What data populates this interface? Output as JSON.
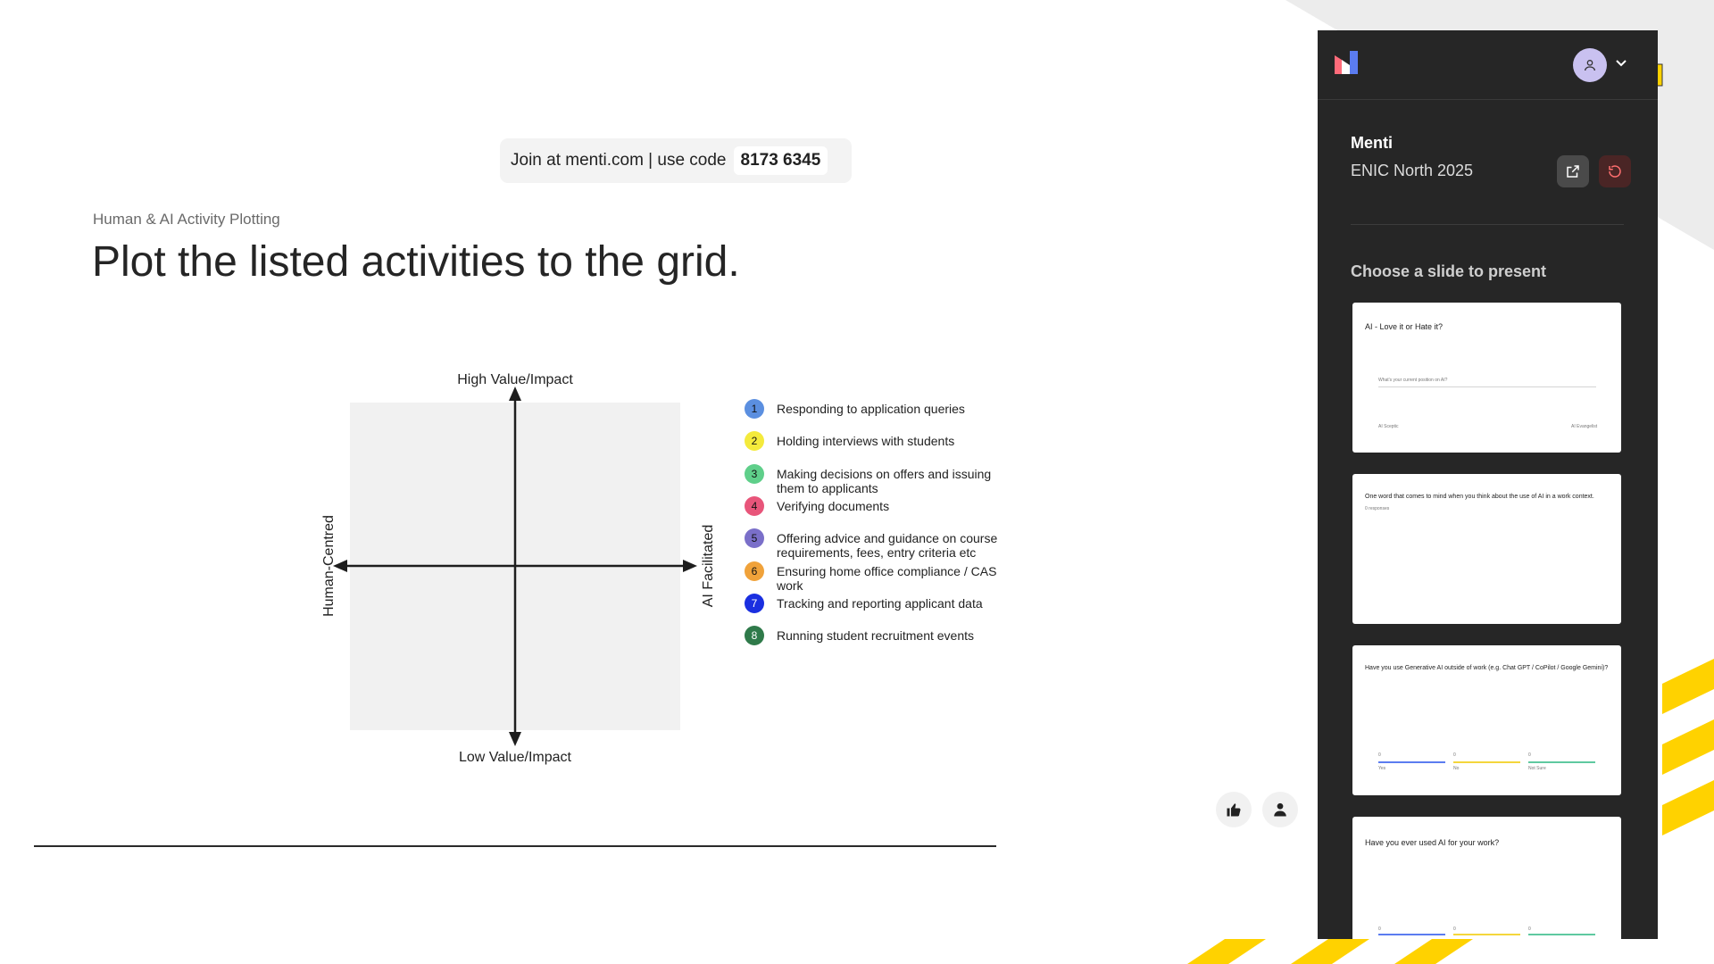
{
  "join_banner": {
    "text": "Join at menti.com | use code",
    "code": "8173 6345"
  },
  "slide": {
    "subtitle": "Human & AI Activity Plotting",
    "title": "Plot the listed activities to the grid.",
    "axes": {
      "top": "High Value/Impact",
      "bottom": "Low Value/Impact",
      "left": "Human-Centred",
      "right": "AI Facilitated"
    },
    "activities": [
      {
        "num": "1",
        "label": "Responding to application queries",
        "color": "#5b8fe0"
      },
      {
        "num": "2",
        "label": "Holding interviews with students",
        "color": "#f4ea3c"
      },
      {
        "num": "3",
        "label": "Making decisions on offers and issuing them to applicants",
        "color": "#5fcf8a"
      },
      {
        "num": "4",
        "label": "Verifying documents",
        "color": "#e8557a"
      },
      {
        "num": "5",
        "label": "Offering advice and guidance on course requirements, fees, entry criteria etc",
        "color": "#7a6fc9"
      },
      {
        "num": "6",
        "label": "Ensuring home office compliance / CAS work",
        "color": "#f0a23a"
      },
      {
        "num": "7",
        "label": "Tracking and reporting applicant data",
        "color": "#1a2fe0"
      },
      {
        "num": "8",
        "label": "Running student recruitment events",
        "color": "#2f7a4a"
      }
    ]
  },
  "reactions": {
    "like_icon": "thumbs-up-icon",
    "participant_icon": "person-icon"
  },
  "panel": {
    "app_name": "Menti",
    "event_name": "ENIC North 2025",
    "choose_label": "Choose a slide to present",
    "accent_colors": {
      "panel_bg": "#262626",
      "reset_bg": "#4a2525",
      "stripe": "#ffd200"
    },
    "slides": [
      {
        "title": "AI - Love it or Hate it?",
        "prompt": "What's your current position on AI?",
        "left_label": "AI Sceptic",
        "right_label": "AI Evangelist"
      },
      {
        "title": "One word that comes to mind when you think about the use of AI in a work context.",
        "responses": "0 responses"
      },
      {
        "title": "Have you use Generative AI outside of work (e.g. Chat GPT / CoPilot / Google Gemini)?",
        "options": [
          {
            "value": "0",
            "label": "Yes"
          },
          {
            "value": "0",
            "label": "No"
          },
          {
            "value": "0",
            "label": "Not Sure"
          }
        ]
      },
      {
        "title": "Have you ever used AI for your work?",
        "options": [
          {
            "value": "0"
          },
          {
            "value": "0"
          },
          {
            "value": "0"
          }
        ]
      }
    ]
  }
}
